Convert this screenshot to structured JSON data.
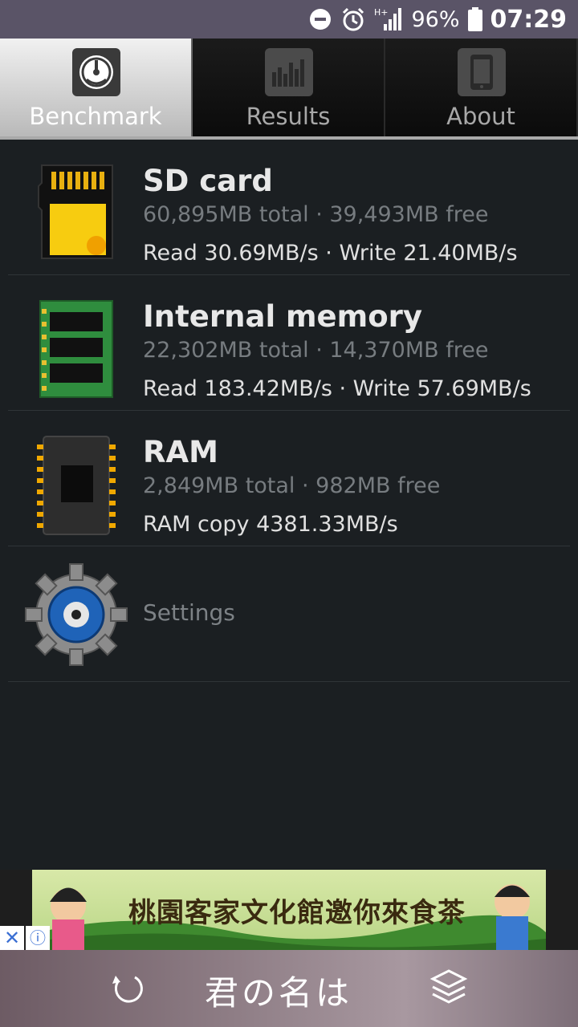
{
  "status_bar": {
    "network": "H+",
    "battery": "96%",
    "time": "07:29"
  },
  "tabs": [
    {
      "label": "Benchmark",
      "icon": "speedometer-icon",
      "active": true
    },
    {
      "label": "Results",
      "icon": "bar-chart-icon",
      "active": false
    },
    {
      "label": "About",
      "icon": "phone-icon",
      "active": false
    }
  ],
  "items": [
    {
      "title": "SD card",
      "subtitle": "60,895MB total · 39,493MB free",
      "stat": "Read 30.69MB/s · Write 21.40MB/s",
      "icon": "sd-card-icon"
    },
    {
      "title": "Internal memory",
      "subtitle": "22,302MB total · 14,370MB free",
      "stat": "Read 183.42MB/s · Write 57.69MB/s",
      "icon": "memory-chip-icon"
    },
    {
      "title": "RAM",
      "subtitle": "2,849MB total · 982MB free",
      "stat": "RAM copy 4381.33MB/s",
      "icon": "ram-chip-icon"
    }
  ],
  "settings": {
    "label": "Settings",
    "icon": "gear-icon"
  },
  "ad": {
    "text": "桃園客家文化館邀你來食茶",
    "close": "✕",
    "info": "ⓘ"
  },
  "bottom_bar": {
    "title": "君の名は"
  }
}
